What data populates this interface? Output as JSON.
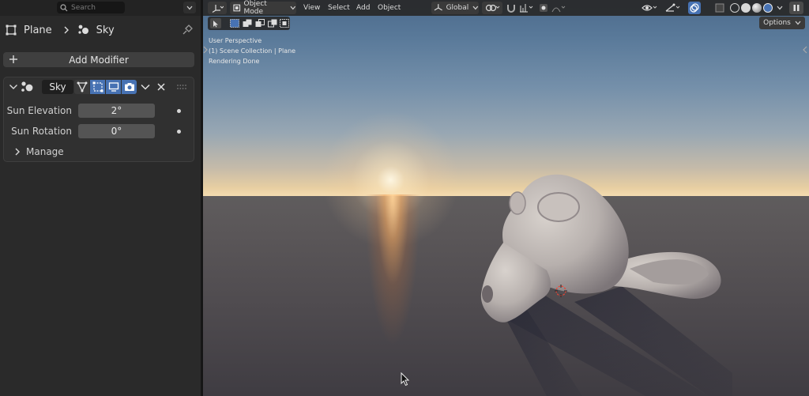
{
  "properties": {
    "search": {
      "placeholder": "Search"
    },
    "breadcrumb": {
      "object": "Plane",
      "modifier": "Sky"
    },
    "add_modifier_label": "Add Modifier",
    "modifier": {
      "name": "Sky",
      "props": [
        {
          "label": "Sun Elevation",
          "value": "2°"
        },
        {
          "label": "Sun Rotation",
          "value": "0°"
        }
      ],
      "manage_label": "Manage"
    }
  },
  "viewport": {
    "header": {
      "mode": "Object Mode",
      "menus": [
        "View",
        "Select",
        "Add",
        "Object"
      ],
      "transform_orientation": "Global",
      "options_label": "Options"
    },
    "info": {
      "perspective": "User Perspective",
      "collection": "(1) Scene Collection | Plane",
      "status": "Rendering Done"
    }
  },
  "colors": {
    "accent": "#4772b3",
    "panel_bg": "#2a2a2a",
    "field_bg": "#545454"
  }
}
